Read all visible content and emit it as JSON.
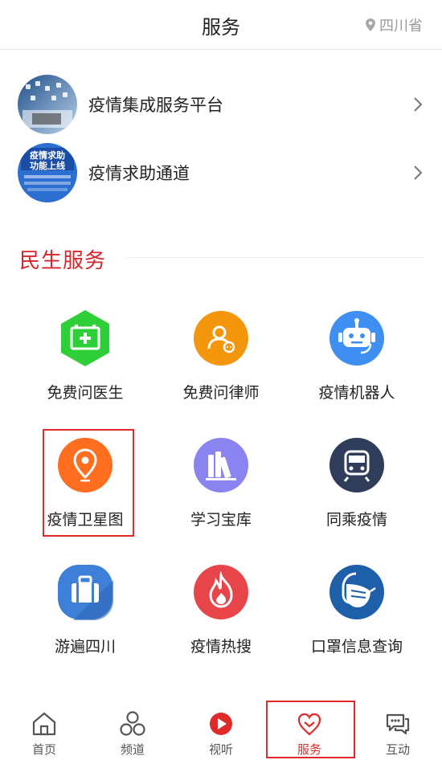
{
  "header": {
    "title": "服务",
    "location": "四川省"
  },
  "platforms": [
    {
      "label": "疫情集成服务平台",
      "thumb_text": ""
    },
    {
      "label": "疫情求助通道",
      "thumb_text": "疫情求助\n功能上线"
    }
  ],
  "section": {
    "title": "民生服务"
  },
  "services": [
    {
      "label": "免费问医生",
      "icon": "medical-kit-icon",
      "color": "#2fcf3a"
    },
    {
      "label": "免费问律师",
      "icon": "lawyer-icon",
      "color": "#f4960c"
    },
    {
      "label": "疫情机器人",
      "icon": "robot-icon",
      "color": "#3f8ff2"
    },
    {
      "label": "疫情卫星图",
      "icon": "location-pin-icon",
      "color": "#ff6d1f"
    },
    {
      "label": "学习宝库",
      "icon": "books-icon",
      "color": "#8a84f0"
    },
    {
      "label": "同乘疫情",
      "icon": "train-icon",
      "color": "#2f3d5b"
    },
    {
      "label": "游遍四川",
      "icon": "luggage-icon",
      "color": "#3e7fd8"
    },
    {
      "label": "疫情热搜",
      "icon": "flame-icon",
      "color": "#e8454b"
    },
    {
      "label": "口罩信息查询",
      "icon": "mask-icon",
      "color": "#1d5fa8"
    }
  ],
  "bottom_nav": [
    {
      "label": "首页",
      "icon": "home-icon",
      "active": false
    },
    {
      "label": "频道",
      "icon": "channels-icon",
      "active": false
    },
    {
      "label": "视听",
      "icon": "play-icon",
      "active": false
    },
    {
      "label": "服务",
      "icon": "heart-hands-icon",
      "active": true
    },
    {
      "label": "互动",
      "icon": "chat-icon",
      "active": false
    }
  ],
  "colors": {
    "accent": "#d7262a",
    "highlight": "#e02a2a"
  }
}
